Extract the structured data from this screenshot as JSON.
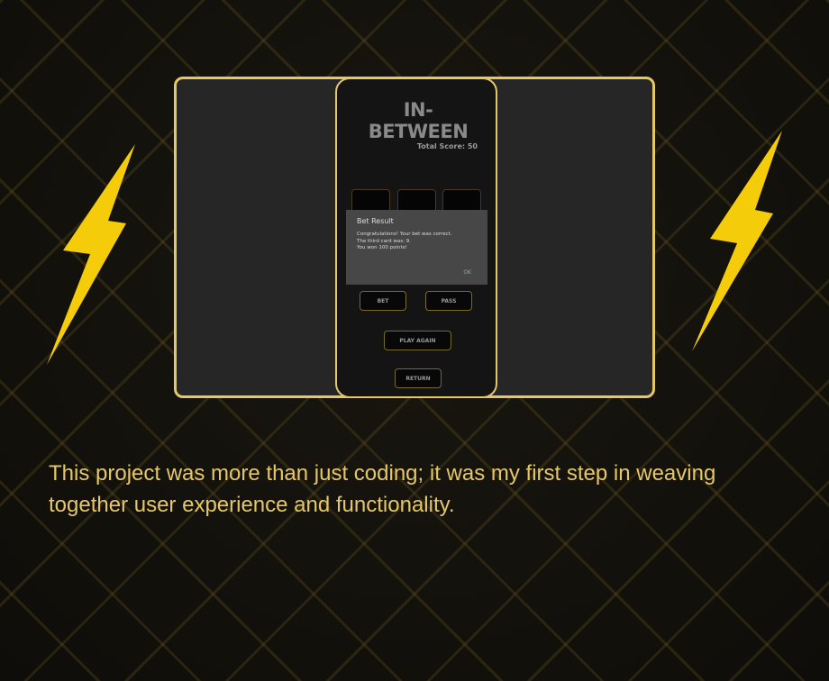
{
  "game": {
    "title": "IN-BETWEEN",
    "total_score": "Total Score: 50"
  },
  "dialog": {
    "title": "Bet Result",
    "lines": [
      "Congratulations! Your bet was correct.",
      "The third card was: 9.",
      "You won 100 points!"
    ],
    "ok_label": "OK"
  },
  "buttons": {
    "bet": "BET",
    "pass": "PASS",
    "play_again": "PLAY AGAIN",
    "return": "RETURN"
  },
  "caption": "This project was more than just coding; it was my first step in weaving together user experience and functionality.",
  "colors": {
    "accent": "#e6c766",
    "bolt": "#f5cc0a"
  },
  "icons": [
    "lightning-bolt-icon"
  ]
}
